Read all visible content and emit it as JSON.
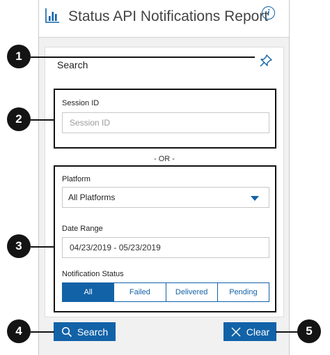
{
  "header": {
    "title": "Status API Notifications Report",
    "report_icon": "bar-chart-icon",
    "info_icon": "info-icon",
    "info_glyph": "i"
  },
  "search_card": {
    "title": "Search",
    "pin_icon": "pin-icon",
    "session_id": {
      "label": "Session ID",
      "placeholder": "Session ID",
      "value": ""
    },
    "or_text": "- OR -",
    "platform": {
      "label": "Platform",
      "selected": "All Platforms"
    },
    "date_range": {
      "label": "Date Range",
      "value": "04/23/2019 - 05/23/2019"
    },
    "notification_status": {
      "label": "Notification Status",
      "options": [
        "All",
        "Failed",
        "Delivered",
        "Pending"
      ],
      "selected": "All"
    }
  },
  "actions": {
    "search_label": "Search",
    "search_icon": "magnifier-icon",
    "clear_label": "Clear",
    "clear_icon": "x-icon"
  },
  "callouts": [
    "1",
    "2",
    "3",
    "4",
    "5"
  ],
  "colors": {
    "accent": "#1262a8",
    "callout": "#141414",
    "panel_bg": "#f1f1f1"
  }
}
